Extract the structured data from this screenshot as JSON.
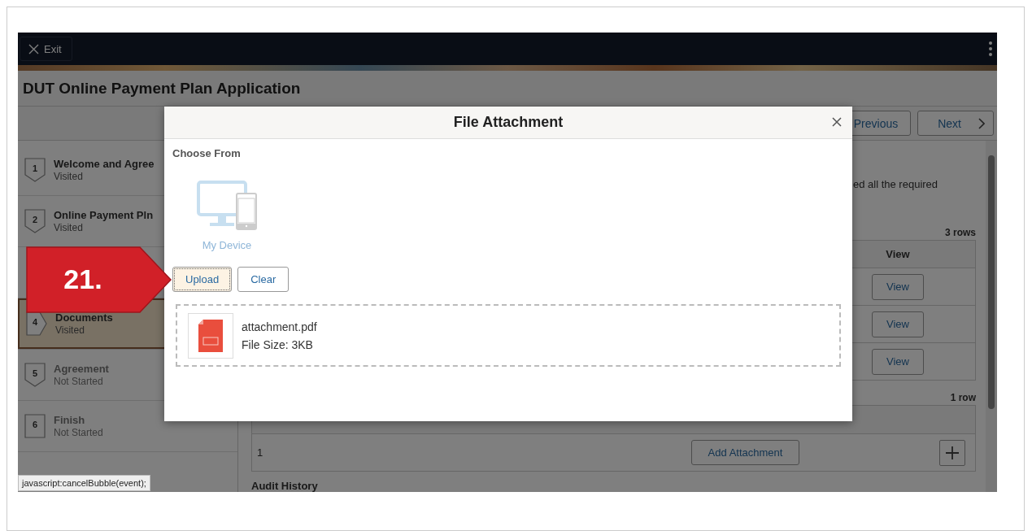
{
  "top_bar": {
    "exit_label": "Exit"
  },
  "page_title": "DUT Online Payment Plan Application",
  "nav": {
    "previous_label": "Previous",
    "next_label": "Next"
  },
  "steps": [
    {
      "number": "1",
      "title": "Welcome and Agree",
      "status": "Visited",
      "selected": false,
      "disabled": false,
      "kind": "step"
    },
    {
      "number": "2",
      "title": "Online Payment Pln",
      "status": "Visited",
      "selected": false,
      "disabled": false,
      "kind": "step"
    },
    {
      "number": "4",
      "title": "Documents",
      "status": "Visited",
      "selected": true,
      "disabled": false,
      "kind": "step"
    },
    {
      "number": "5",
      "title": "Agreement",
      "status": "Not Started",
      "selected": false,
      "disabled": true,
      "kind": "step"
    },
    {
      "number": "6",
      "title": "Finish",
      "status": "Not Started",
      "selected": false,
      "disabled": true,
      "kind": "final"
    }
  ],
  "main": {
    "intro_text": "ed all the required",
    "documents_table": {
      "row_count": "3 rows",
      "columns": [
        "View"
      ],
      "rows": [
        {
          "action": "View"
        },
        {
          "action": "View"
        },
        {
          "action": "View"
        }
      ]
    },
    "attachments_table": {
      "row_count": "1 row",
      "rows": [
        {
          "number": "1",
          "action": "Add Attachment"
        }
      ]
    },
    "audit_heading": "Audit History"
  },
  "modal": {
    "title": "File Attachment",
    "choose_from_label": "Choose From",
    "source_label": "My Device",
    "buttons": [
      {
        "label": "Upload",
        "focused": true
      },
      {
        "label": "Clear",
        "focused": false
      }
    ],
    "files": [
      {
        "name": "attachment.pdf",
        "size": "File Size: 3KB"
      }
    ]
  },
  "callout": {
    "label": "21."
  },
  "status_tooltip": "javascript:cancelBubble(event);"
}
